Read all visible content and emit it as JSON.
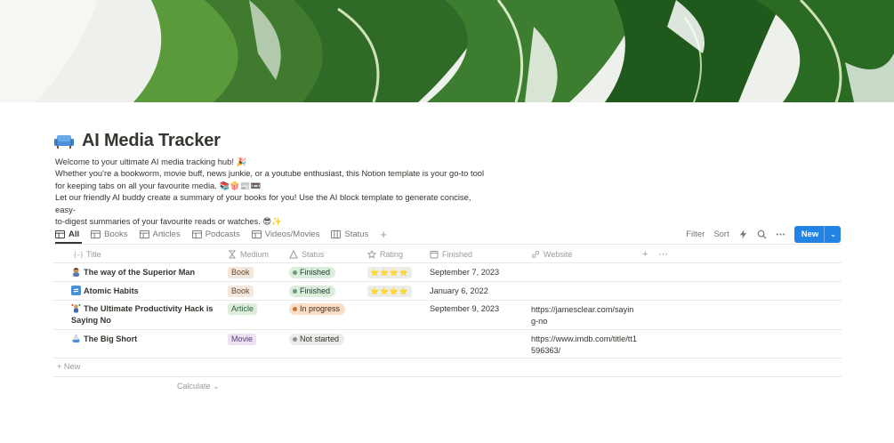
{
  "page": {
    "icon": "couch-icon",
    "title": "AI Media Tracker",
    "description": [
      "Welcome to your ultimate AI media tracking hub! 🎉",
      "Whether you're a bookworm, movie buff, news junkie, or a youtube enthusiast, this Notion template is your go-to tool",
      "for keeping tabs on all your favourite media. 📚🍿📰📼",
      "Let our friendly AI buddy create a summary of your books for you! Use the AI block template to generate concise, easy-",
      "to-digest summaries of your favourite reads or watches. 😎✨"
    ]
  },
  "views": [
    {
      "label": "All",
      "icon": "table-icon",
      "active": true
    },
    {
      "label": "Books",
      "icon": "table-icon"
    },
    {
      "label": "Articles",
      "icon": "table-icon"
    },
    {
      "label": "Podcasts",
      "icon": "table-icon"
    },
    {
      "label": "Videos/Movies",
      "icon": "table-icon"
    },
    {
      "label": "Status",
      "icon": "board-icon"
    }
  ],
  "toolbar": {
    "filter": "Filter",
    "sort": "Sort",
    "new": "New"
  },
  "columns": {
    "title": "Title",
    "medium": "Medium",
    "status": "Status",
    "rating": "Rating",
    "finished": "Finished",
    "website": "Website"
  },
  "rows": [
    {
      "emoji": "man-icon",
      "title": "The way of the Superior Man",
      "medium": "Book",
      "status": "Finished",
      "rating": "⭐⭐⭐⭐",
      "finished": "September 7, 2023",
      "website": ""
    },
    {
      "emoji": "repeat-icon",
      "title": "Atomic Habits",
      "medium": "Book",
      "status": "Finished",
      "rating": "⭐⭐⭐⭐",
      "finished": "January 6, 2022",
      "website": ""
    },
    {
      "emoji": "juggler-icon",
      "title": "The Ultimate Productivity Hack is Saying No",
      "medium": "Article",
      "status": "In progress",
      "rating": "",
      "finished": "September 9, 2023",
      "website": "https://jamesclear.com/saying-no"
    },
    {
      "emoji": "sailboat-icon",
      "title": "The Big Short",
      "medium": "Movie",
      "status": "Not started",
      "rating": "",
      "finished": "",
      "website": "https://www.imdb.com/title/tt1596363/"
    }
  ],
  "footer": {
    "add_new": "+ New",
    "calculate": "Calculate ⌄"
  },
  "colors": {
    "accent": "#2383e2",
    "text": "#37352f",
    "muted": "#9b9a97"
  }
}
